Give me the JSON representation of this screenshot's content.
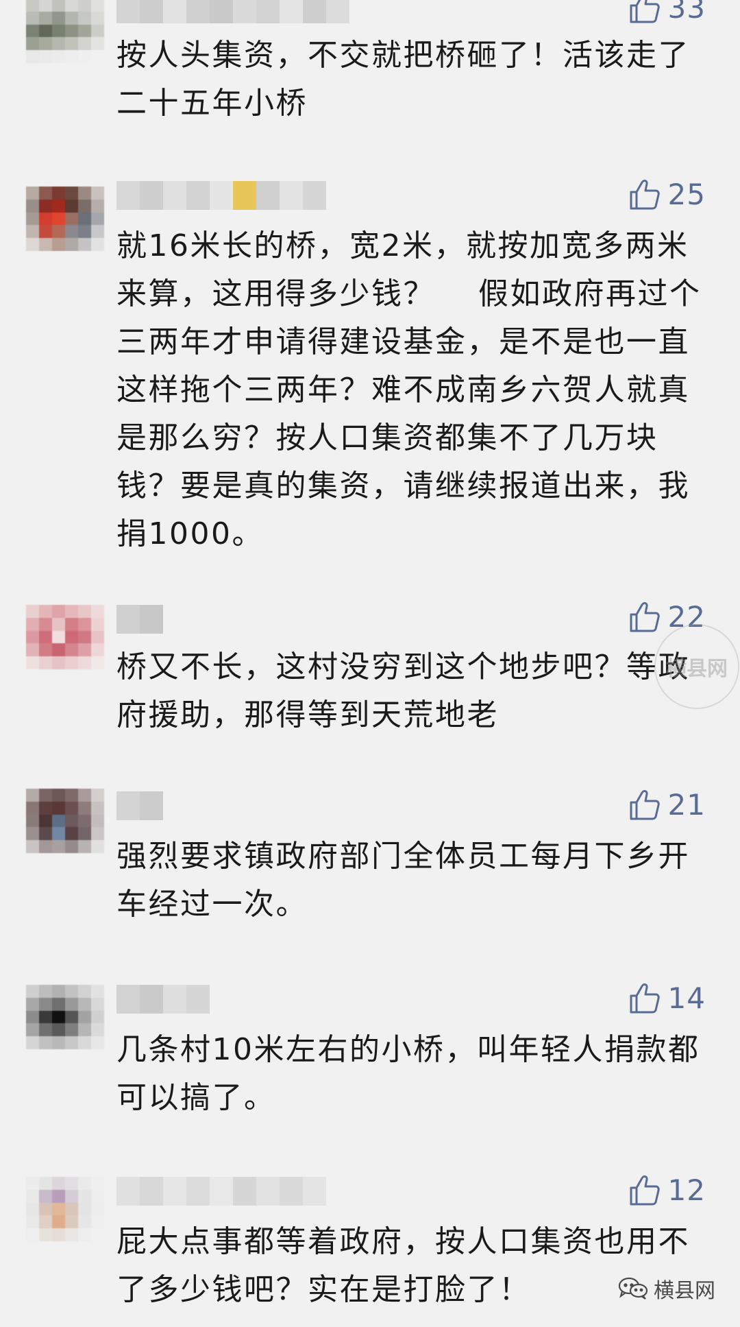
{
  "comments": [
    {
      "likes": "33",
      "text": "按人头集资，不交就把桥砸了！活该走了二十五年小桥"
    },
    {
      "likes": "25",
      "text": "就16米长的桥，宽2米，就按加宽多两米来算，这用得多少钱？　 假如政府再过个三两年才申请得建设基金，是不是也一直这样拖个三两年？难不成南乡六贺人就真是那么穷？按人口集资都集不了几万块钱？要是真的集资，请继续报道出来，我捐1000。"
    },
    {
      "likes": "22",
      "text": "桥又不长，这村没穷到这个地步吧？等政府援助，那得等到天荒地老"
    },
    {
      "likes": "21",
      "text": "强烈要求镇政府部门全体员工每月下乡开车经过一次。"
    },
    {
      "likes": "14",
      "text": "几条村10米左右的小桥，叫年轻人捐款都可以搞了。"
    },
    {
      "likes": "12",
      "text": "屁大点事都等着政府，按人口集资也用不了多少钱吧？实在是打脸了！"
    }
  ],
  "watermark_text": "横县网",
  "brand": {
    "icon": "wechat-icon",
    "label": "横县网"
  },
  "colors": {
    "background": "#f1f1f1",
    "like_blue": "#576b95",
    "text": "#1a1a1a"
  }
}
